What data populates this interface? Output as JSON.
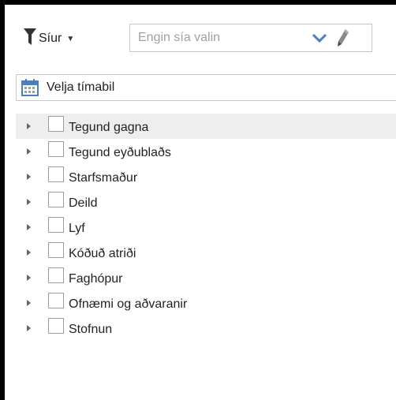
{
  "toolbar": {
    "filter_label": "Síur",
    "filter_icon": "funnel-icon",
    "caret_icon": "caret-down-icon",
    "select_placeholder": "Engin sía valin",
    "chevron_icon": "chevron-down-icon",
    "edit_icon": "pencil-icon"
  },
  "period": {
    "label": "Velja tímabil",
    "icon": "calendar-icon"
  },
  "tree": {
    "items": [
      {
        "label": "Tegund gagna"
      },
      {
        "label": "Tegund eyðublaðs"
      },
      {
        "label": "Starfsmaður"
      },
      {
        "label": "Deild"
      },
      {
        "label": "Lyf"
      },
      {
        "label": "Kóðuð atriði"
      },
      {
        "label": "Faghópur"
      },
      {
        "label": "Ofnæmi og aðvaranir"
      },
      {
        "label": "Stofnun"
      }
    ]
  },
  "colors": {
    "border": "#c8c8c8",
    "placeholder": "#9aa3a8",
    "icon_blue": "#4a7fc1",
    "row_highlight": "#eeeeee"
  }
}
